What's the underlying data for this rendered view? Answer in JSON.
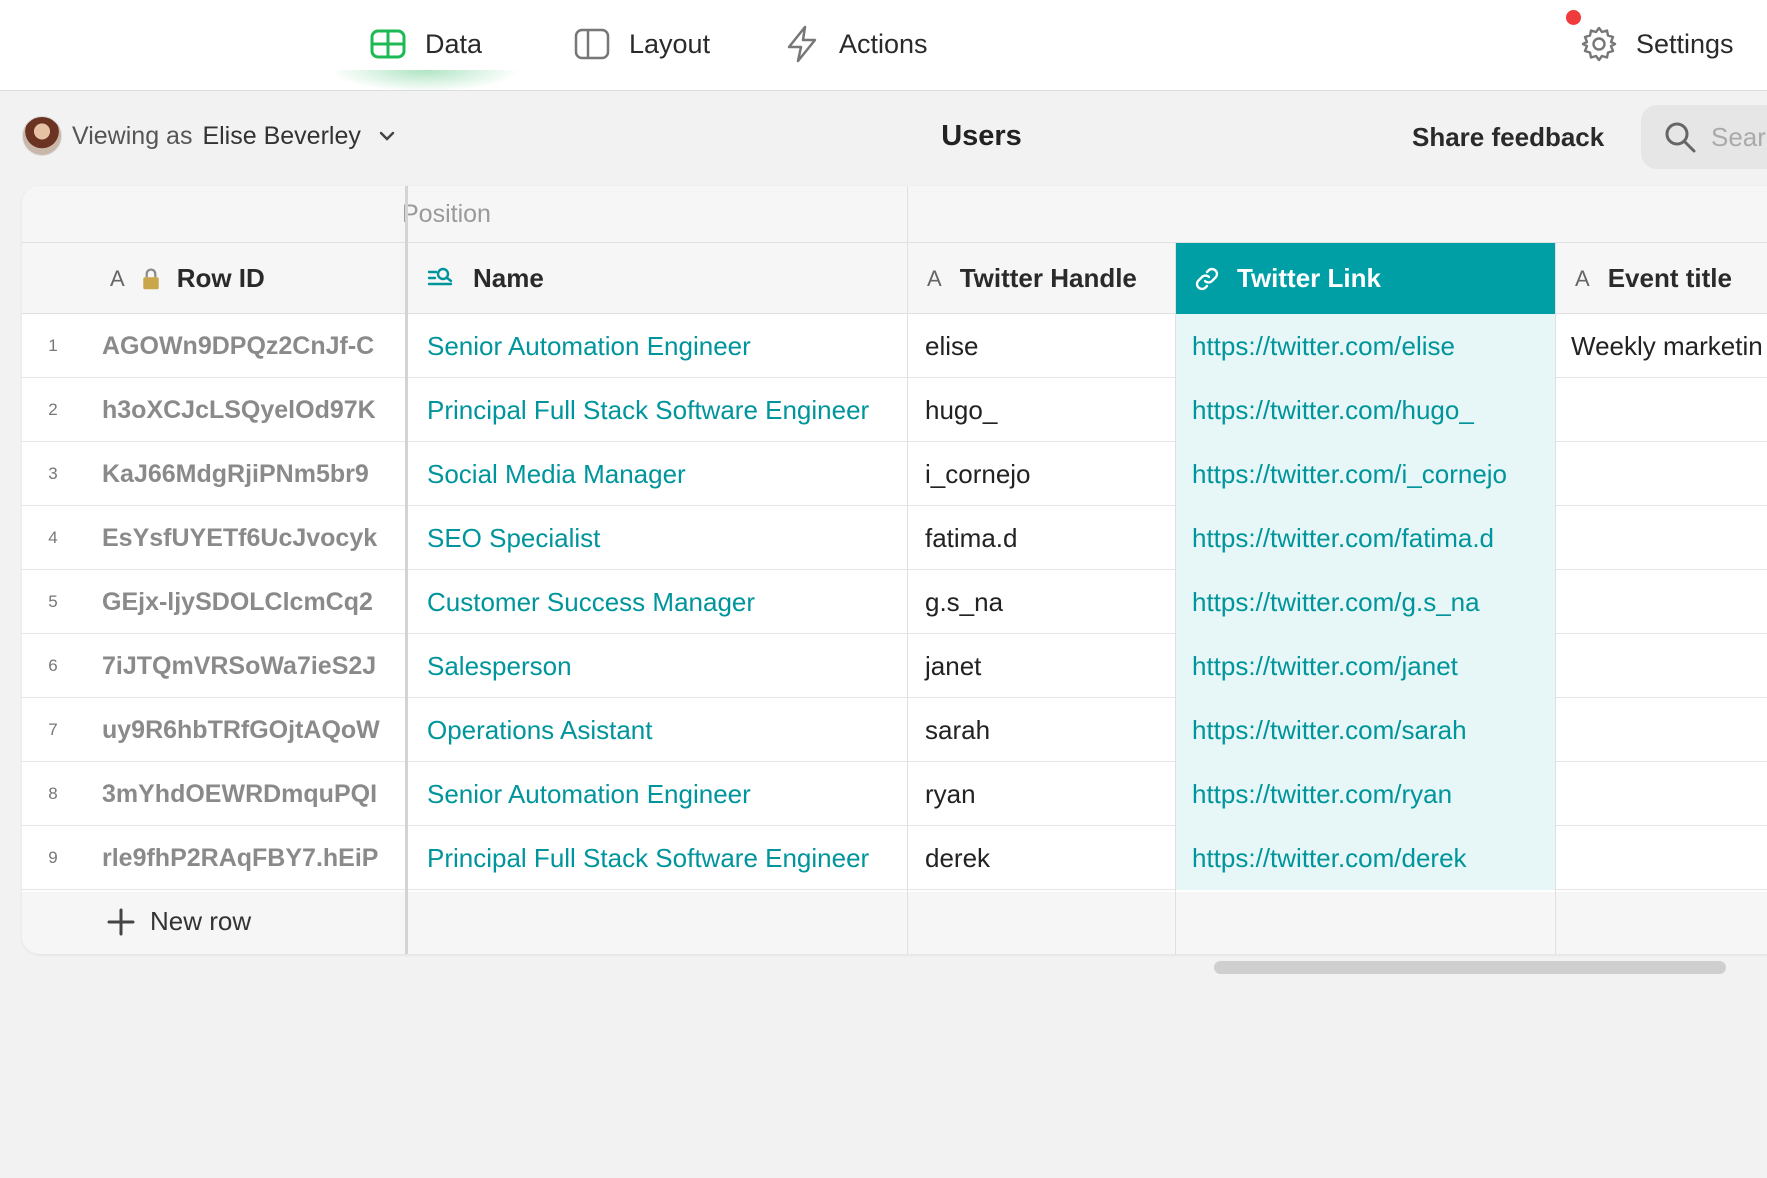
{
  "nav": {
    "data_label": "Data",
    "layout_label": "Layout",
    "actions_label": "Actions",
    "settings_label": "Settings"
  },
  "header": {
    "viewing_prefix": "Viewing as",
    "viewing_user": "Elise Beverley",
    "title": "Users",
    "share_label": "Share feedback",
    "search_placeholder": "Search"
  },
  "table": {
    "group_label": "Position",
    "columns": {
      "row_id": "Row ID",
      "name": "Name",
      "handle": "Twitter Handle",
      "link": "Twitter Link",
      "event": "Event title"
    },
    "type_icon_text": "A",
    "rows": [
      {
        "num": "1",
        "id": "AGOWn9DPQz2CnJf-C",
        "name": "Senior Automation Engineer",
        "handle": "elise",
        "link": "https://twitter.com/elise",
        "event": "Weekly marketin"
      },
      {
        "num": "2",
        "id": "h3oXCJcLSQyelOd97K",
        "name": "Principal Full Stack Software Engineer",
        "handle": "hugo_",
        "link": "https://twitter.com/hugo_",
        "event": ""
      },
      {
        "num": "3",
        "id": "KaJ66MdgRjiPNm5br9",
        "name": "Social Media Manager",
        "handle": "i_cornejo",
        "link": "https://twitter.com/i_cornejo",
        "event": ""
      },
      {
        "num": "4",
        "id": "EsYsfUYETf6UcJvocyk",
        "name": "SEO Specialist",
        "handle": "fatima.d",
        "link": "https://twitter.com/fatima.d",
        "event": ""
      },
      {
        "num": "5",
        "id": "GEjx-ljySDOLClcmCq2",
        "name": "Customer Success Manager",
        "handle": "g.s_na",
        "link": "https://twitter.com/g.s_na",
        "event": ""
      },
      {
        "num": "6",
        "id": "7iJTQmVRSoWa7ieS2J",
        "name": "Salesperson",
        "handle": "janet",
        "link": "https://twitter.com/janet",
        "event": ""
      },
      {
        "num": "7",
        "id": "uy9R6hbTRfGOjtAQoW",
        "name": "Operations Asistant",
        "handle": "sarah",
        "link": "https://twitter.com/sarah",
        "event": ""
      },
      {
        "num": "8",
        "id": "3mYhdOEWRDmquPQI",
        "name": "Senior Automation Engineer",
        "handle": "ryan",
        "link": "https://twitter.com/ryan",
        "event": ""
      },
      {
        "num": "9",
        "id": "rle9fhP2RAqFBY7.hEiP",
        "name": "Principal Full Stack Software Engineer",
        "handle": "derek",
        "link": "https://twitter.com/derek",
        "event": ""
      }
    ],
    "new_row_label": "New row"
  },
  "colors": {
    "accent": "#009fa6",
    "link": "#00959c",
    "active_nav": "#1db954",
    "notification": "#ef3b3b"
  },
  "icons": {
    "data": "table-grid-icon",
    "layout": "layout-panel-icon",
    "actions": "lightning-icon",
    "settings": "gear-icon",
    "search": "search-icon",
    "lock": "lock-icon",
    "link": "link-icon",
    "name": "search-list-icon",
    "add": "plus-icon"
  }
}
